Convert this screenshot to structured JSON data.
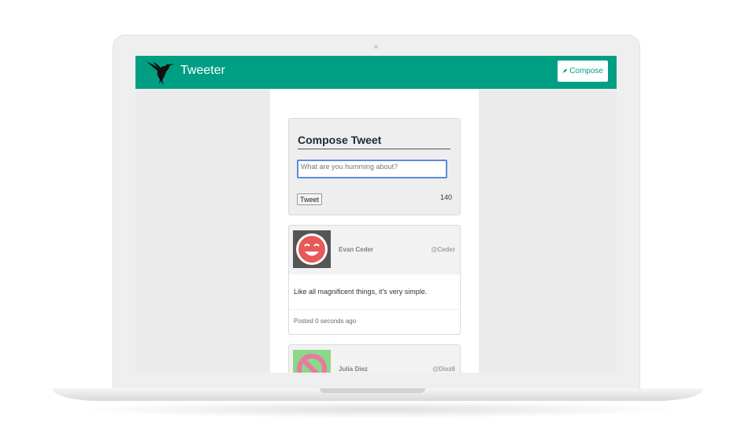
{
  "app": {
    "brand": "Tweeter",
    "compose_button": "Compose",
    "accent_color": "#009e82"
  },
  "compose": {
    "title": "Compose Tweet",
    "placeholder": "What are you humming about?",
    "submit_label": "Tweet",
    "remaining_chars": "140"
  },
  "tweets": [
    {
      "name": "Evan Ceder",
      "handle": "@Ceder",
      "text": "Like all magnificent things, it's very simple.",
      "posted": "Posted 0 seconds ago",
      "avatar_icon": "smiley-face-avatar",
      "avatar_bg": "#555555",
      "avatar_color": "#e8595a"
    },
    {
      "name": "Julia Diez",
      "handle": "@Diez6",
      "avatar_icon": "no-symbol-avatar",
      "avatar_bg": "#8bd88b",
      "avatar_color": "#e87aa0"
    }
  ]
}
